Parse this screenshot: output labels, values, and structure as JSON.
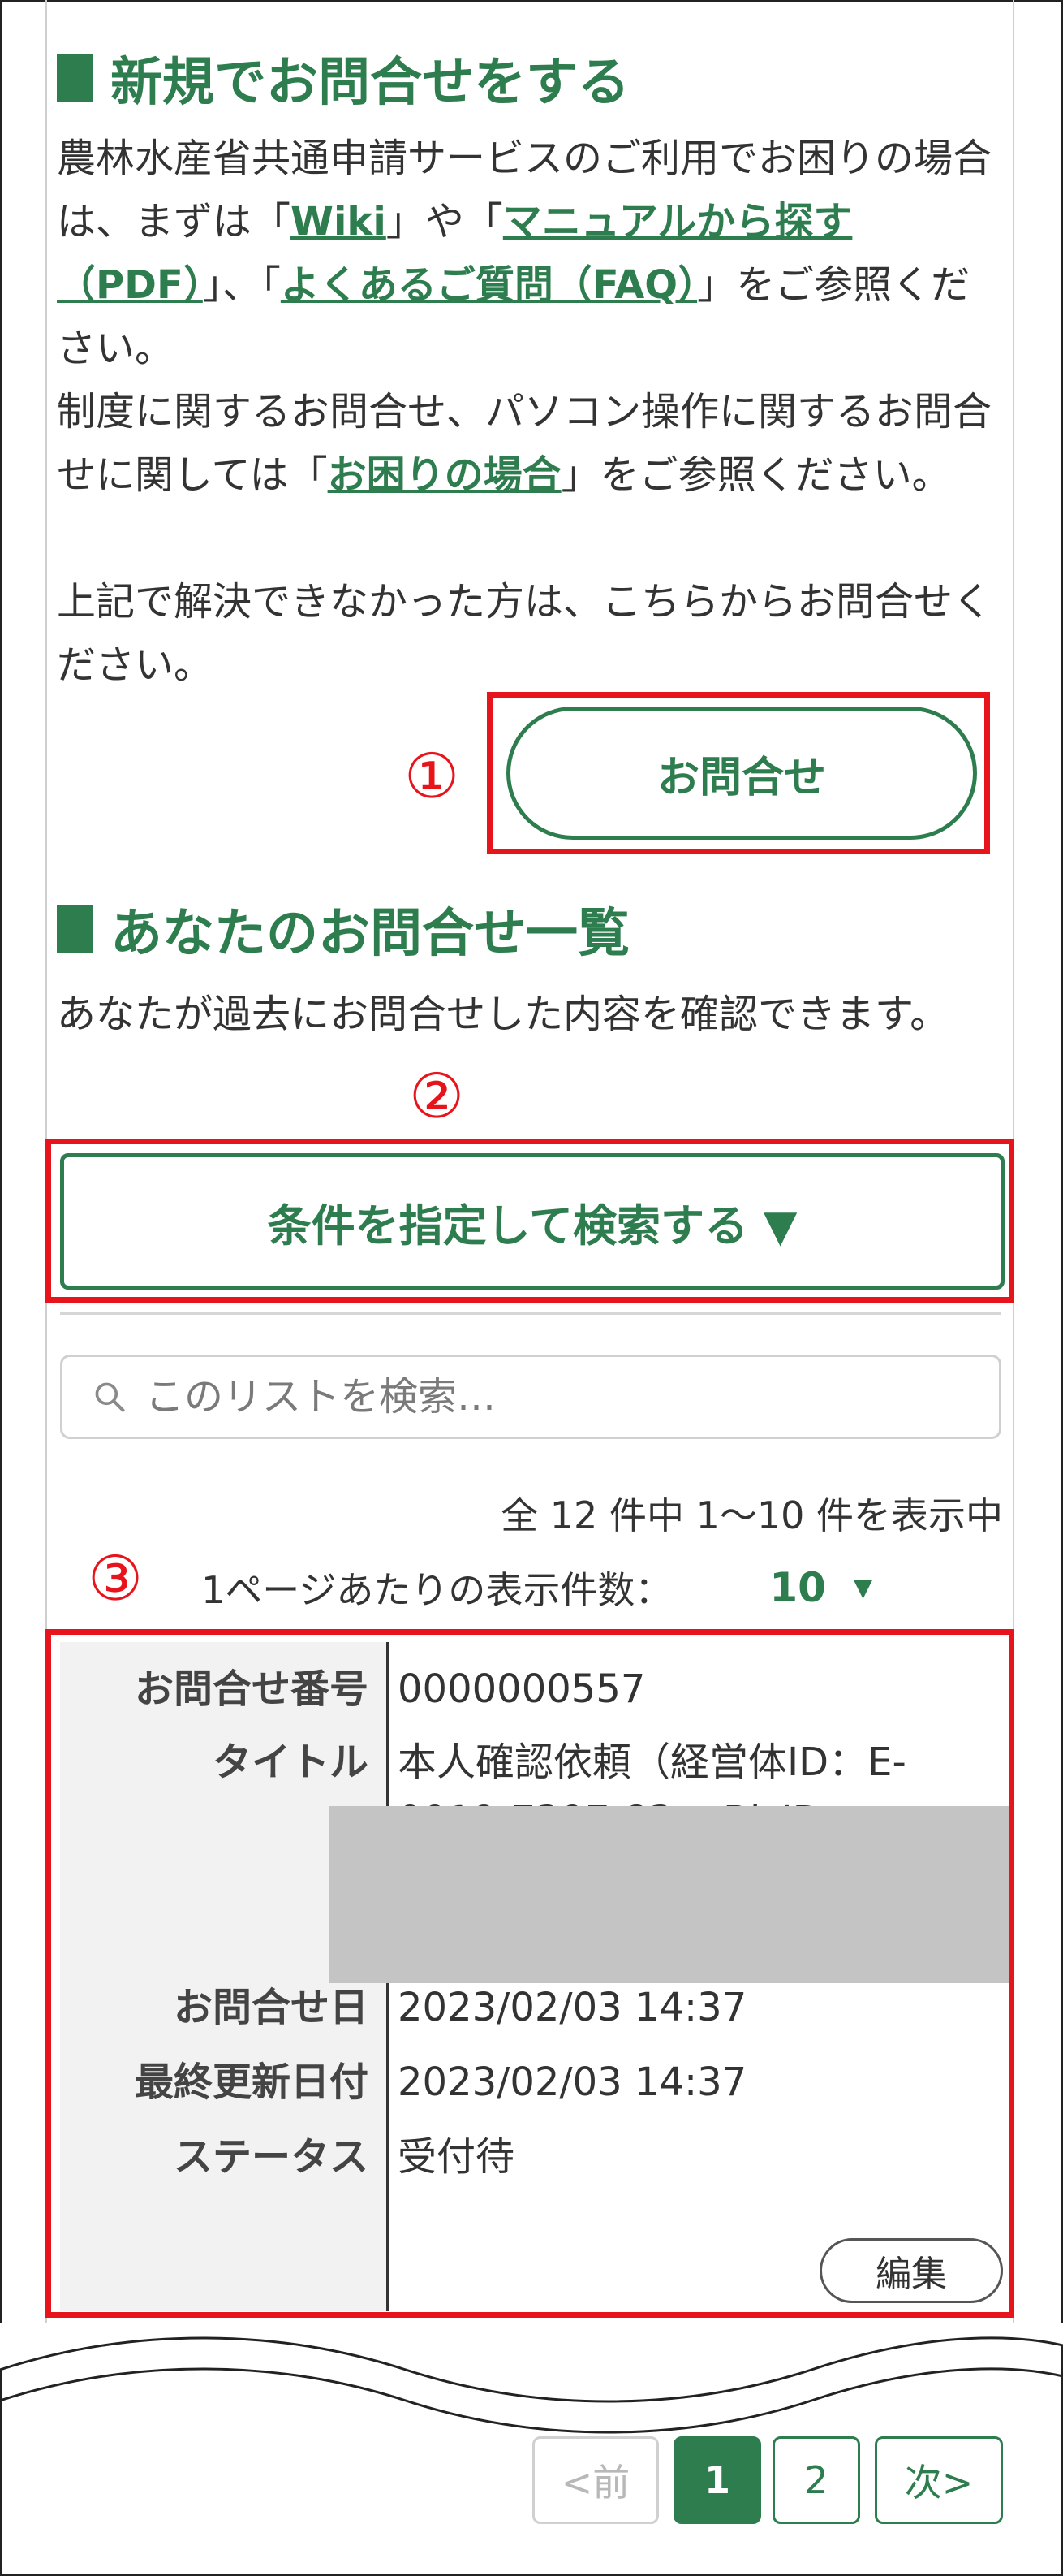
{
  "new_inquiry": {
    "heading": "新規でお問合せをする",
    "p1_before": "農林水産省共通申請サービスのご利用でお困りの場合は、まずは「",
    "link_wiki": "Wiki",
    "p1_mid1": "」や「",
    "link_manual": "マニュアルから探す（PDF）",
    "p1_mid2": "」、「",
    "link_faq": "よくあるご質問（FAQ）",
    "p1_after": "」をご参照ください。",
    "p2_before": "制度に関するお問合せ、パソコン操作に関するお問合せに関しては「",
    "link_trouble": "お困りの場合",
    "p2_after": "」をご参照ください。",
    "p3": "上記で解決できなかった方は、こちらからお問合せください。",
    "button": "お問合せ"
  },
  "inquiry_list": {
    "heading": "あなたのお問合せ一覧",
    "description": "あなたが過去にお問合せした内容を確認できます。",
    "search_button": "条件を指定して検索する ▼",
    "search_placeholder": "このリストを検索…",
    "count_text": "全 12 件中 1〜10 件を表示中",
    "per_page_label": "1ページあたりの表示件数：",
    "per_page_value": "10",
    "record": {
      "labels": {
        "number": "お問合せ番号",
        "title": "タイトル",
        "date": "お問合せ日",
        "updated": "最終更新日付",
        "status": "ステータス"
      },
      "values": {
        "number": "0000000557",
        "title": "本人確認依頼（経営体ID：E-0019-7397-83, gBizID",
        "date": "2023/02/03 14:37",
        "updated": "2023/02/03 14:37",
        "status": "受付待"
      },
      "edit_button": "編集"
    }
  },
  "pagination": {
    "prev": "<前",
    "pages": [
      "1",
      "2"
    ],
    "next": "次>",
    "current": "1"
  },
  "annotations": [
    "①",
    "②",
    "③"
  ],
  "colors": {
    "accent": "#2e7d4f",
    "highlight_red": "#e8141c",
    "redaction": "#c4c4c4"
  }
}
